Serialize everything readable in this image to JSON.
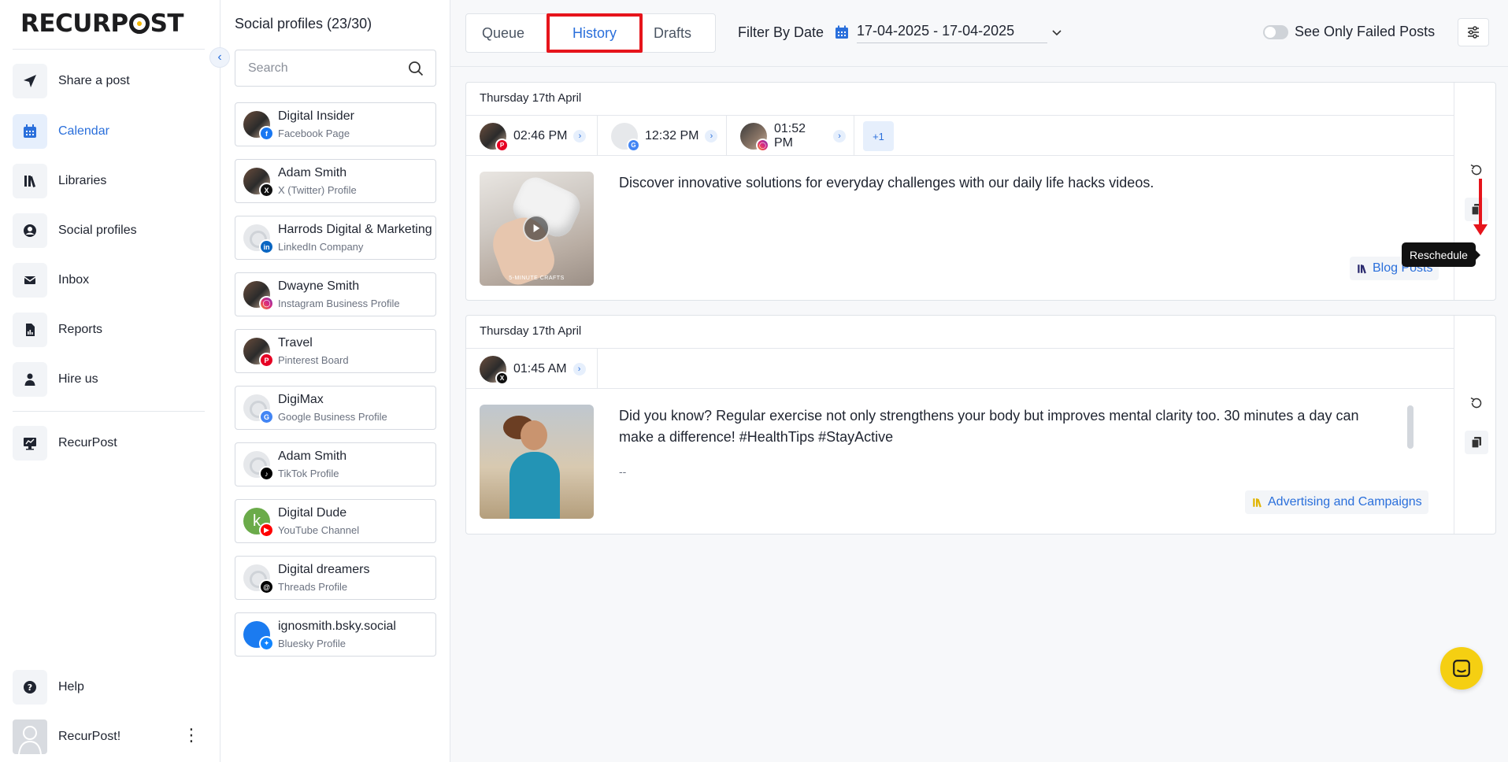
{
  "brand": {
    "logo_text_left": "RECURP",
    "logo_text_right": "ST",
    "accent": "#2a6fdb",
    "highlight": "#e6141b"
  },
  "nav": {
    "items": [
      {
        "label": "Share a post",
        "icon": "send-icon"
      },
      {
        "label": "Calendar",
        "icon": "calendar-icon",
        "active": true
      },
      {
        "label": "Libraries",
        "icon": "libraries-icon"
      },
      {
        "label": "Social profiles",
        "icon": "user-circle-icon"
      },
      {
        "label": "Inbox",
        "icon": "mail-icon"
      },
      {
        "label": "Reports",
        "icon": "report-icon"
      },
      {
        "label": "Hire us",
        "icon": "person-icon"
      }
    ],
    "workspace": {
      "label": "RecurPost",
      "icon": "monitor-icon"
    },
    "help": {
      "label": "Help",
      "icon": "help-icon"
    },
    "user": {
      "label": "RecurPost!"
    }
  },
  "profiles": {
    "title": "Social profiles (23/30)",
    "search_placeholder": "Search",
    "items": [
      {
        "name": "Digital Insider",
        "type": "Facebook Page",
        "network": "facebook"
      },
      {
        "name": "Adam Smith",
        "type": "X (Twitter) Profile",
        "network": "x"
      },
      {
        "name": "Harrods Digital & Marketing",
        "type": "LinkedIn Company",
        "network": "linkedin"
      },
      {
        "name": "Dwayne Smith",
        "type": "Instagram Business Profile",
        "network": "instagram"
      },
      {
        "name": "Travel",
        "type": "Pinterest Board",
        "network": "pinterest"
      },
      {
        "name": "DigiMax",
        "type": "Google Business Profile",
        "network": "google"
      },
      {
        "name": "Adam Smith",
        "type": "TikTok Profile",
        "network": "tiktok"
      },
      {
        "name": "Digital Dude",
        "type": "YouTube Channel",
        "network": "youtube",
        "initial": "k"
      },
      {
        "name": "Digital dreamers",
        "type": "Threads Profile",
        "network": "threads"
      },
      {
        "name": "ignosmith.bsky.social",
        "type": "Bluesky Profile",
        "network": "bluesky"
      }
    ]
  },
  "toolbar": {
    "tabs": [
      {
        "label": "Queue"
      },
      {
        "label": "History",
        "active": true
      },
      {
        "label": "Drafts"
      }
    ],
    "filter_label": "Filter By Date",
    "date_range": "17-04-2025 - 17-04-2025",
    "failed_toggle_label": "See Only Failed Posts",
    "failed_toggle_on": false
  },
  "posts": [
    {
      "date": "Thursday 17th April",
      "schedules": [
        {
          "time": "02:46 PM",
          "network": "pinterest"
        },
        {
          "time": "12:32 PM",
          "network": "google"
        },
        {
          "time": "01:52 PM",
          "network": "instagram"
        }
      ],
      "more": "+1",
      "text": "Discover innovative solutions for everyday challenges with our daily life hacks videos.",
      "media_caption": "5-MINUTE CRAFTS",
      "library": "Blog Posts",
      "library_color": "#2a2a6e"
    },
    {
      "date": "Thursday 17th April",
      "schedules": [
        {
          "time": "01:45 AM",
          "network": "x"
        }
      ],
      "text": "Did you know? Regular exercise not only strengthens your body but improves mental clarity too. 30 minutes a day can make a difference! #HealthTips #StayActive",
      "dash": "--",
      "library": "Advertising and Campaigns",
      "library_color": "#e0b400"
    }
  ],
  "tooltip": "Reschedule"
}
